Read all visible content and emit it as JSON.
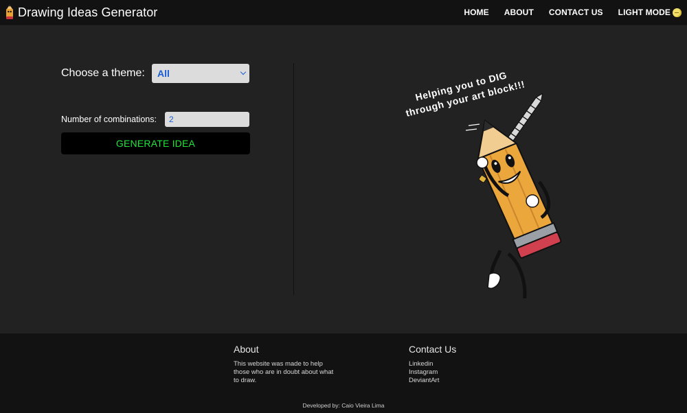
{
  "navbar": {
    "title": "Drawing Ideas Generator",
    "logo_icon": "pencil-icon",
    "links": [
      {
        "label": "HOME"
      },
      {
        "label": "ABOUT"
      },
      {
        "label": "CONTACT US"
      }
    ],
    "theme_toggle": {
      "label": "LIGHT MODE",
      "icon": "moon-icon"
    }
  },
  "form": {
    "theme_label": "Choose a theme:",
    "theme_selected": "All",
    "combinations_label": "Number of combinations:",
    "combinations_value": "2",
    "generate_label": "GENERATE IDEA"
  },
  "illustration": {
    "slogan_line1": "Helping you to DIG",
    "slogan_line2": "through your art block!!!"
  },
  "footer": {
    "about": {
      "heading": "About",
      "text": "This website was made to help those who are in doubt about what to draw."
    },
    "contact": {
      "heading": "Contact Us",
      "links": [
        "Linkedin",
        "Instagram",
        "DeviantArt"
      ]
    },
    "credit": "Developed by: Caio Vieira Lima"
  },
  "colors": {
    "background": "#222222",
    "navbar": "#121212",
    "footer": "#121212",
    "button_text": "#22e43a",
    "input_text": "#1a5dd6"
  }
}
